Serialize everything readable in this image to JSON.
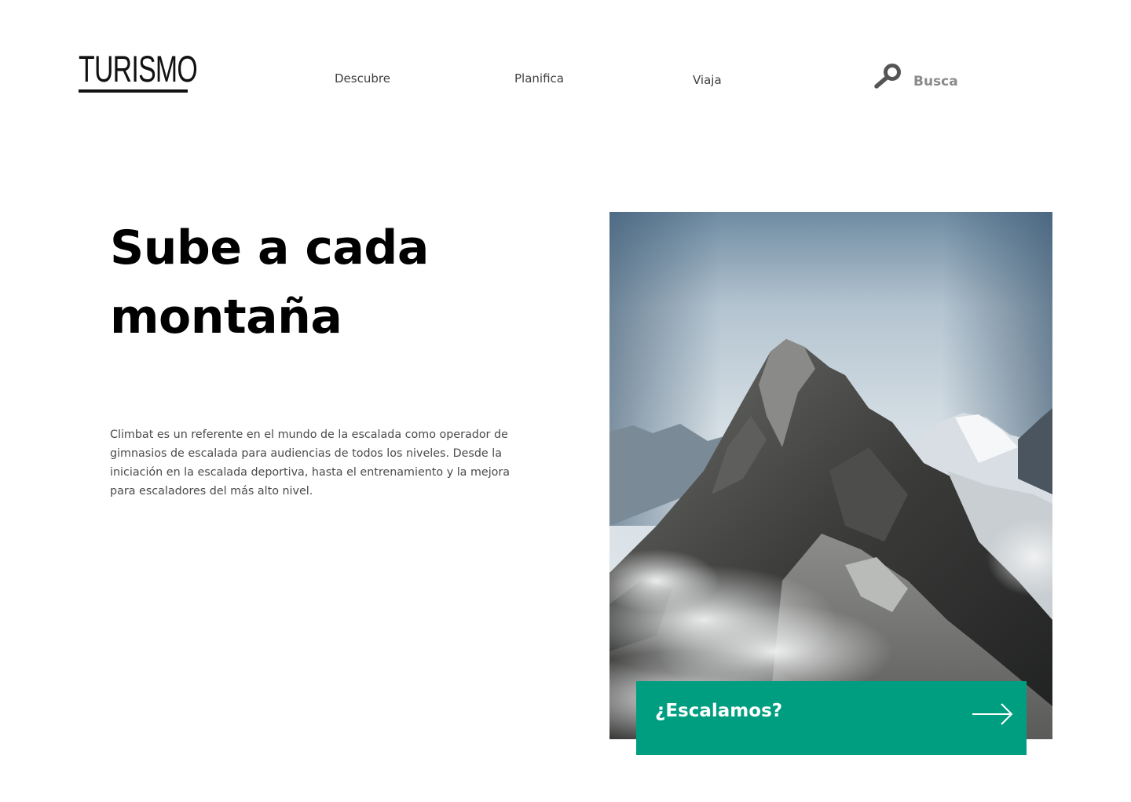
{
  "header": {
    "logo_text": "TURISMO",
    "nav": [
      {
        "label": "Descubre"
      },
      {
        "label": "Planifica"
      },
      {
        "label": "Viaja"
      }
    ],
    "search": {
      "icon": "search-icon",
      "label": "Busca"
    }
  },
  "hero": {
    "title": "Sube a cada montaña",
    "description": "Climbat es un referente en el mundo de la escalada como operador de gimnasios de escalada para audiencias de todos los niveles. Desde la iniciación en la escalada deportiva, hasta el entrenamiento y la mejora para escaladores del más alto nivel.",
    "image": {
      "subject": "snow-capped-mountain-peak-photo"
    },
    "cta": {
      "label": "¿Escalamos?",
      "icon": "arrow-right-icon"
    }
  },
  "colors": {
    "accent": "#009e80",
    "text": "#000000",
    "muted": "#8a8a8a",
    "background": "#ffffff"
  }
}
